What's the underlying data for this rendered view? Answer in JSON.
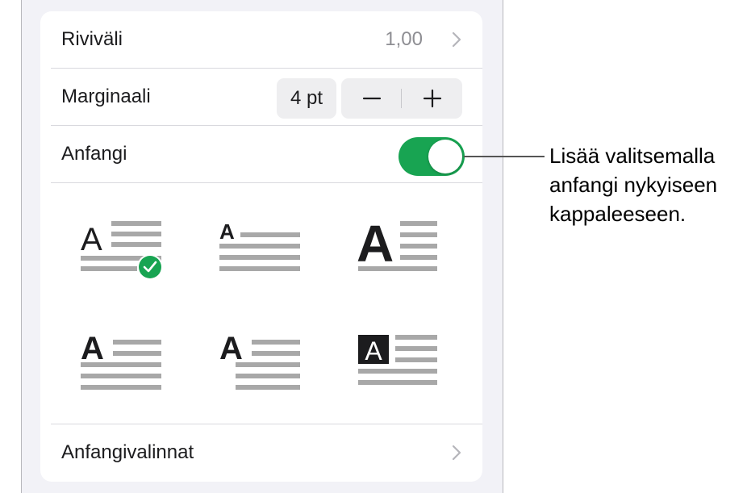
{
  "line_spacing": {
    "label": "Riviväli",
    "value": "1,00"
  },
  "margin": {
    "label": "Marginaali",
    "value": "4 pt",
    "decrement_icon": "minus-icon",
    "increment_icon": "plus-icon"
  },
  "drop_cap": {
    "label": "Anfangi",
    "enabled": true,
    "accent_color": "#18a452"
  },
  "drop_cap_styles": {
    "letter": "A",
    "options": [
      {
        "id": "style-1",
        "selected": true
      },
      {
        "id": "style-2",
        "selected": false
      },
      {
        "id": "style-3",
        "selected": false
      },
      {
        "id": "style-4",
        "selected": false
      },
      {
        "id": "style-5",
        "selected": false
      },
      {
        "id": "style-6",
        "selected": false
      }
    ]
  },
  "drop_cap_options": {
    "label": "Anfangivalinnat"
  },
  "callout": {
    "lines": [
      "Lisää valitsemalla",
      "anfangi nykyiseen",
      "kappaleeseen."
    ]
  }
}
